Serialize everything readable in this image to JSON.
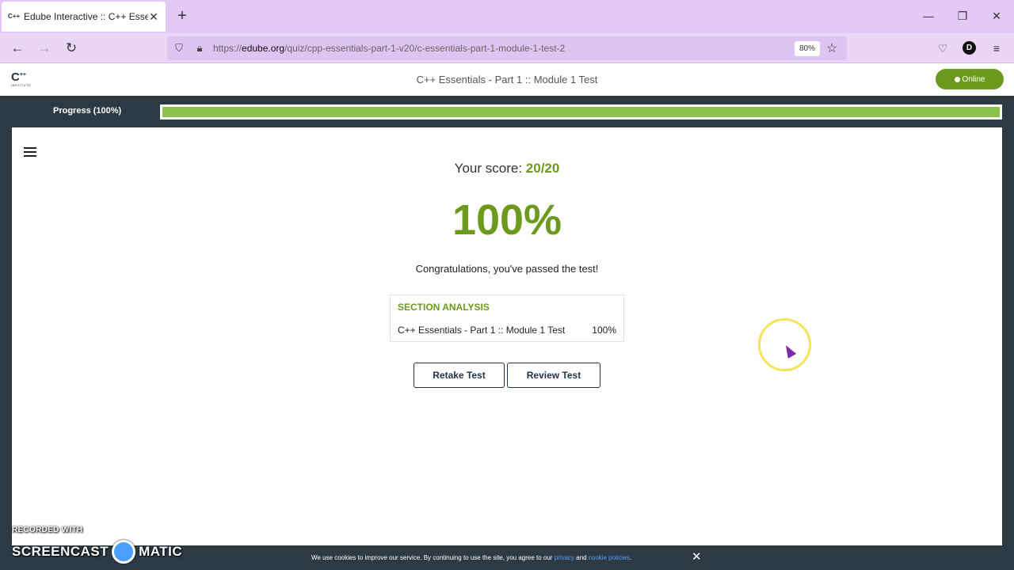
{
  "browser": {
    "tab_title": "Edube Interactive :: C++ Essenti",
    "tab_favicon": "C++",
    "url_prefix": "https://",
    "url_host": "edube.org",
    "url_path": "/quiz/cpp-essentials-part-1-v20/c-essentials-part-1-module-1-test-2",
    "zoom": "80%",
    "profile_initial": "D"
  },
  "header": {
    "logo_text": "C",
    "logo_sup": "++",
    "logo_sub": "INSTITUTE",
    "title": "C++ Essentials - Part 1 :: Module 1 Test",
    "online_label": "Online"
  },
  "progress": {
    "label": "Progress (100%)",
    "value": 1.0
  },
  "result": {
    "score_label": "Your score:",
    "score_value": "20/20",
    "percent": "100%",
    "message": "Congratulations, you've passed the test!"
  },
  "analysis": {
    "title": "SECTION ANALYSIS",
    "rows": [
      {
        "name": "C++ Essentials - Part 1 :: Module 1 Test",
        "percent": "100%"
      }
    ]
  },
  "actions": {
    "retake": "Retake Test",
    "review": "Review Test"
  },
  "cookie": {
    "text": "We use cookies to improve our service. By continuing to use the site, you agree to our",
    "privacy": "privacy",
    "and": "and",
    "cookie_policies": "cookie policies",
    "period": "."
  },
  "watermark": {
    "line1": "RECORDED WITH",
    "line2a": "SCREENCAST",
    "line2b": "MATIC"
  },
  "colors": {
    "accent": "#6b9a1c",
    "progress": "#8bc34a",
    "dark": "#2d3a44",
    "chrome": "#e4c8f5"
  }
}
